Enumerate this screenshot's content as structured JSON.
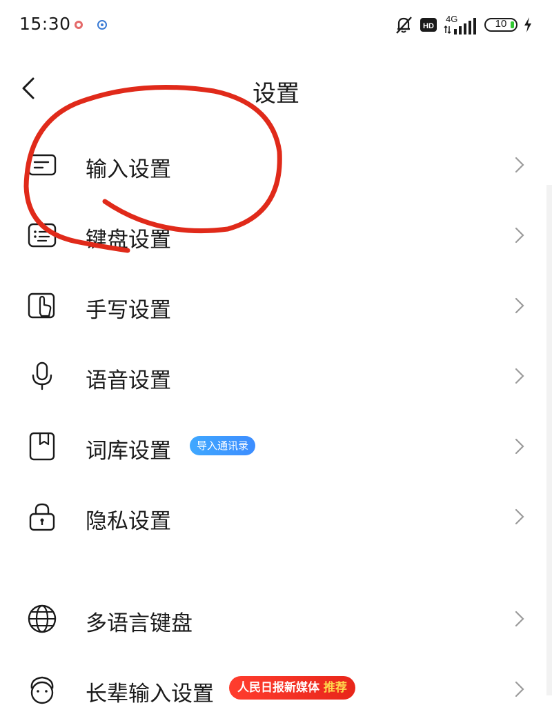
{
  "status_bar": {
    "time": "15:30",
    "network": "4G",
    "hd_label": "HD",
    "battery": "10",
    "icons": [
      "app-notification-icon",
      "app-notification-icon",
      "mute-bell-icon",
      "hd-icon",
      "signal-icon",
      "battery-icon",
      "charging-icon"
    ]
  },
  "header": {
    "title": "设置",
    "back_icon": "chevron-left-icon"
  },
  "settings": {
    "items": [
      {
        "label": "输入设置",
        "icon": "input-settings-icon"
      },
      {
        "label": "键盘设置",
        "icon": "keyboard-icon"
      },
      {
        "label": "手写设置",
        "icon": "handwriting-icon"
      },
      {
        "label": "语音设置",
        "icon": "microphone-icon"
      },
      {
        "label": "词库设置",
        "icon": "dictionary-icon",
        "badge": "导入通讯录"
      },
      {
        "label": "隐私设置",
        "icon": "lock-icon"
      },
      {
        "label": "多语言键盘",
        "icon": "globe-icon"
      },
      {
        "label": "长辈输入设置",
        "icon": "elder-icon",
        "badge_main": "人民日报新媒体",
        "badge_highlight": "推荐"
      }
    ]
  },
  "colors": {
    "annotation": "#e02a1a",
    "badge_blue": "#3d9bff",
    "badge_red": "#ff3d2e",
    "text": "#1a1a1a",
    "chevron": "#9a9a9a"
  }
}
